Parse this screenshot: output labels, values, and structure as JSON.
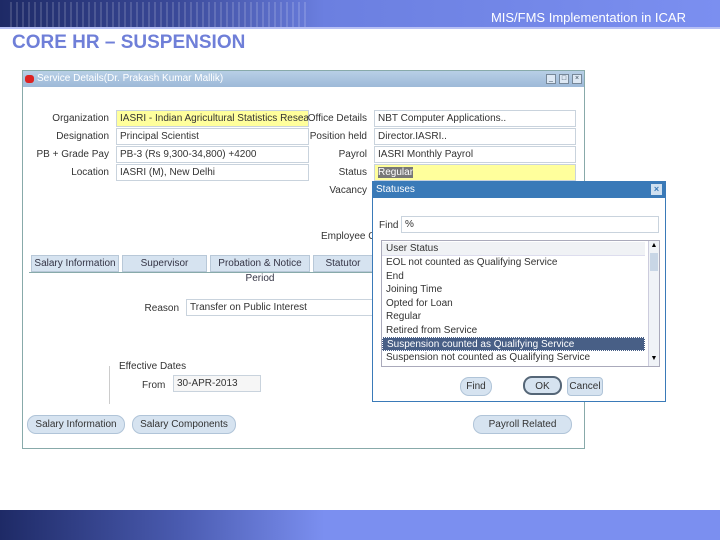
{
  "slide": {
    "subtitle": "MIS/FMS Implementation in ICAR",
    "title": "CORE HR – SUSPENSION"
  },
  "window": {
    "title": "Service Details(Dr. Prakash Kumar Mallik)"
  },
  "form": {
    "organization": {
      "label": "Organization",
      "value": "IASRI - Indian Agricultural Statistics Research"
    },
    "designation": {
      "label": "Designation",
      "value": "Principal Scientist"
    },
    "pb_grade": {
      "label": "PB + Grade Pay",
      "value": "PB-3 (Rs 9,300-34,800) +4200"
    },
    "location": {
      "label": "Location",
      "value": "IASRI (M), New Delhi"
    },
    "office_details": {
      "label": "Office Details",
      "value": "NBT Computer Applications.."
    },
    "position_held": {
      "label": "Position held",
      "value": "Director.IASRI.."
    },
    "payroll": {
      "label": "Payrol",
      "value": "IASRI Monthly Payrol"
    },
    "status": {
      "label": "Status",
      "value": "Regular"
    },
    "vacancy": {
      "label": "Vacancy"
    },
    "employee_c": {
      "label": "Employee C"
    },
    "reason": {
      "label": "Reason",
      "value": "Transfer on Public Interest"
    },
    "effective_dates": {
      "label": "Effective Dates",
      "from_label": "From",
      "from_value": "30-APR-2013"
    }
  },
  "tabs": [
    "Salary Information",
    "Supervisor",
    "Probation & Notice Period",
    "Statutor"
  ],
  "buttons": {
    "salary_info": "Salary Information",
    "salary_components": "Salary Components",
    "payroll_related": "Payroll Related"
  },
  "dialog": {
    "title": "Statuses",
    "find_label": "Find",
    "find_value": "%",
    "column": "User Status",
    "items": [
      "EOL not counted as Qualifying Service",
      "End",
      "Joining Time",
      "Opted for Loan",
      "Regular",
      "Retired from Service",
      "Suspension counted as Qualifying Service",
      "Suspension not counted as Qualifying Service"
    ],
    "selected_index": 6,
    "find_button": "Find",
    "ok_button": "OK",
    "cancel_button": "Cancel"
  }
}
